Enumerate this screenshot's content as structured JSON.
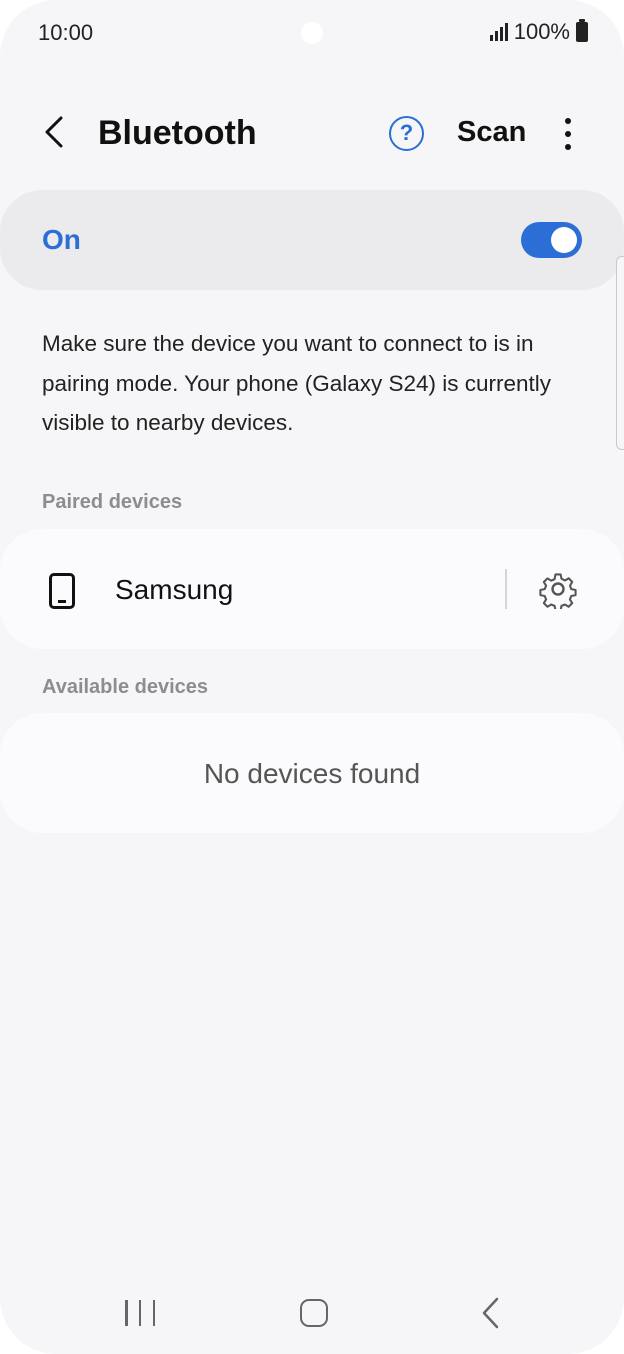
{
  "status_bar": {
    "time": "10:00",
    "battery": "100%"
  },
  "header": {
    "title": "Bluetooth",
    "help_label": "?",
    "scan_label": "Scan"
  },
  "toggle": {
    "label": "On",
    "state": "on",
    "color": "#2b6fd6"
  },
  "description": "Make sure the device you want to connect to is in pairing mode. Your phone (Galaxy S24) is currently visible to nearby devices.",
  "paired": {
    "header": "Paired devices",
    "devices": [
      {
        "name": "Samsung",
        "icon": "phone-icon"
      }
    ]
  },
  "available": {
    "header": "Available devices",
    "empty_text": "No devices found"
  },
  "nav": {
    "recents": "recents-icon",
    "home": "home-icon",
    "back": "back-icon"
  }
}
